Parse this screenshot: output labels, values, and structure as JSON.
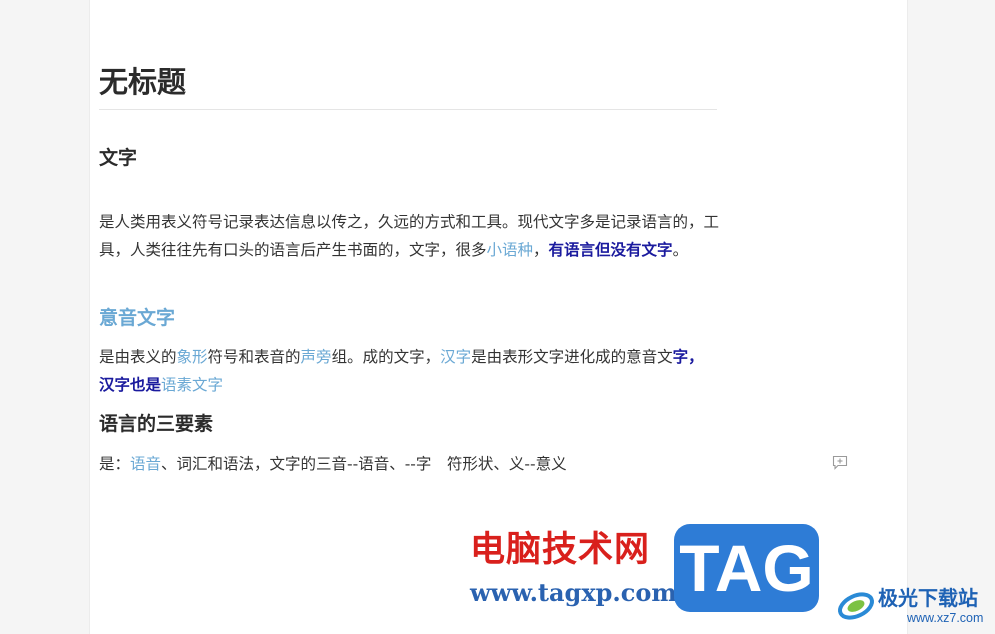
{
  "document": {
    "title": "无标题",
    "sections": [
      {
        "heading": "文字",
        "paragraph": {
          "t1": "是人类用表义符号记录表达信息以传之，久远的方式和工具。现代文字多是记录语言的，工具，人类往往先有口头的语言后产生书面的，文字，很多",
          "link1": "小语种",
          "t2": "，",
          "strong1": "有语言但没有文字",
          "t3": "。"
        }
      },
      {
        "heading": "意音文字",
        "paragraph": {
          "t1": "是由表义的",
          "link1": "象形",
          "t2": "符号和表音的",
          "link2": "声旁",
          "t3": "组。成的文字，",
          "link3": "汉字",
          "t4": "是由表形文字进化成的意音文",
          "strong1": "字，汉字也是",
          "link4": "语素文字"
        }
      },
      {
        "heading": "语言的三要素",
        "paragraph": {
          "t1": "是：",
          "link1": "语音",
          "t2": "、词汇和语法，文字的三音--语音、--字　符形状、义--意义"
        }
      }
    ]
  },
  "comment_icon": "comment-add-icon",
  "watermark": {
    "cn_text": "电脑技术网",
    "url": "www.tagxp.com",
    "badge": "TAG",
    "site_name": "极光下载站",
    "site_url": "www.xz7.com"
  },
  "colors": {
    "link": "#6aa8d4",
    "strong_link": "#1a1a9e",
    "text": "#333333",
    "watermark_red": "#d9201c",
    "watermark_blue": "#2e7cd6"
  }
}
